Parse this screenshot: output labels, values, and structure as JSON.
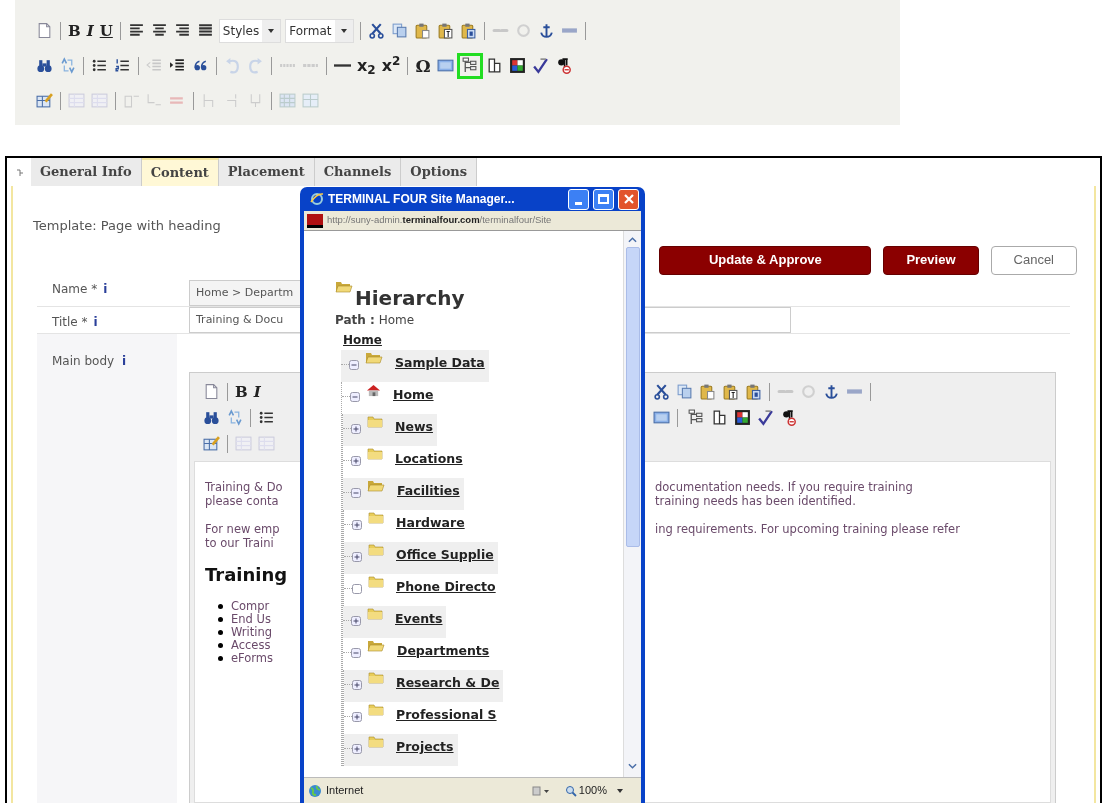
{
  "main_toolbar": {
    "glyphs": [
      {
        "text": "B",
        "kind": "bold"
      },
      {
        "text": "I",
        "kind": "italic"
      },
      {
        "text": "U",
        "kind": "underline"
      },
      {
        "text": "x$_{2}$",
        "kind": "script"
      },
      {
        "text": "x$^{2}$",
        "kind": "script"
      },
      {
        "text": "Ω",
        "kind": "symbol"
      }
    ],
    "styles_dropdown": "Styles",
    "format_dropdown": "Format",
    "tree_button_highlighted": true
  },
  "tabs": [
    {
      "label": "General Info",
      "selected": false
    },
    {
      "label": "Content",
      "selected": true
    },
    {
      "label": "Placement",
      "selected": false
    },
    {
      "label": "Channels",
      "selected": false
    },
    {
      "label": "Options",
      "selected": false
    }
  ],
  "template_label": "Template: Page with heading",
  "buttons": [
    {
      "label": "Update & Approve",
      "kind": "primary"
    },
    {
      "label": "Preview",
      "kind": "primary"
    },
    {
      "label": "Cancel",
      "kind": "secondary"
    }
  ],
  "fields": [
    {
      "label": "Name *",
      "info": "i",
      "value": "Home > Departm"
    },
    {
      "label": "Title *",
      "info": "i",
      "value": "Training & Docu"
    }
  ],
  "main_body": {
    "label": "Main body",
    "info": "i",
    "toolbar": {
      "glyphs": [
        {
          "text": "B",
          "kind": "bold"
        },
        {
          "text": "I",
          "kind": "italic"
        }
      ],
      "tree_button_highlighted": false
    },
    "content_left": {
      "paragraphs": [
        [
          "Training & Do",
          "please conta"
        ],
        [
          "For new emp",
          "to our Traini"
        ]
      ],
      "heading": "Training",
      "list": [
        "Compr",
        "End Us",
        "Writing",
        "Access",
        "eForms"
      ]
    },
    "content_right": {
      "paragraphs": [
        [
          "documentation needs. If you require training",
          "training needs has been identified."
        ],
        [
          "ing requirements. For upcoming training please refer"
        ]
      ]
    }
  },
  "popup": {
    "title": "TERMINAL FOUR Site Manager...",
    "address": "http://suny-admin.**terminalfour.com**/terminalfour/Site",
    "heading": "Hierarchy",
    "path": "**Path :** Home",
    "root": "Home",
    "tree": [
      {
        "label": "Sample Data",
        "kind": "folder",
        "expanded": true,
        "children": [
          {
            "label": "Home",
            "kind": "home",
            "expanded": true,
            "children": [
              {
                "label": "News",
                "kind": "folder",
                "expanded": false
              },
              {
                "label": "Locations",
                "kind": "folder",
                "expanded": false
              },
              {
                "label": "Facilities",
                "kind": "folder",
                "expanded": true,
                "children": [
                  {
                    "label": "Hardware",
                    "kind": "folder",
                    "expanded": false
                  },
                  {
                    "label": "Office Supplie",
                    "kind": "folder",
                    "expanded": false
                  },
                  {
                    "label": "Phone Directo",
                    "kind": "folder"
                  }
                ]
              },
              {
                "label": "Events",
                "kind": "folder",
                "expanded": false
              },
              {
                "label": "Departments",
                "kind": "folder",
                "expanded": true,
                "children": [
                  {
                    "label": "Research & De",
                    "kind": "folder",
                    "expanded": false
                  },
                  {
                    "label": "Professional S",
                    "kind": "folder",
                    "expanded": false
                  },
                  {
                    "label": "Projects",
                    "kind": "folder",
                    "expanded": false
                  }
                ]
              }
            ]
          }
        ]
      }
    ],
    "status": {
      "zone": "Internet",
      "zoom": "100%"
    }
  }
}
